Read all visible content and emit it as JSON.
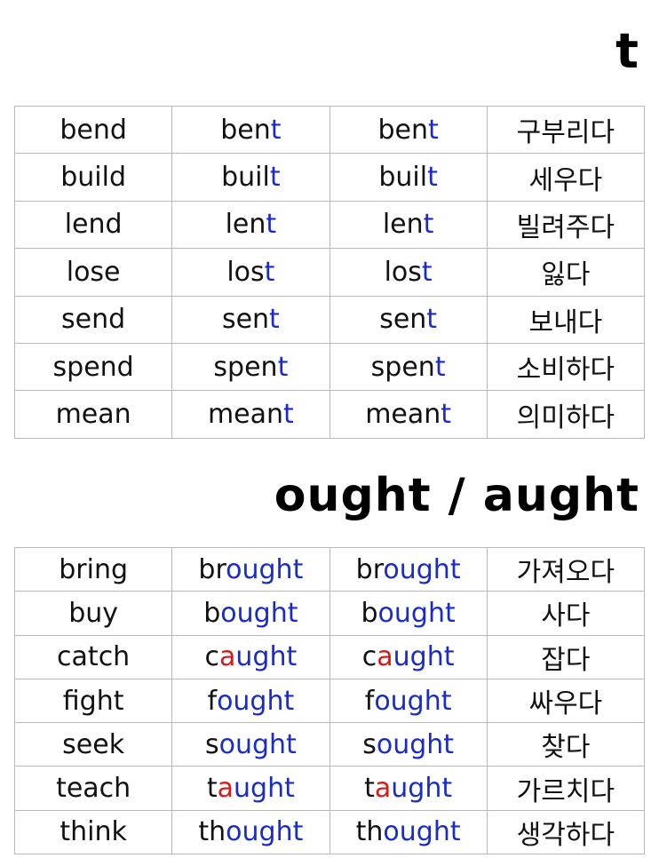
{
  "colors": {
    "changed_part": "#1a2cc7",
    "vowel_highlight": "#d61a1a",
    "text": "#111111",
    "border": "#b8b8b8"
  },
  "sections": [
    {
      "title": "t",
      "rows": [
        {
          "base": "bend",
          "past": [
            {
              "t": "ben"
            },
            {
              "t": "t",
              "c": "blue"
            }
          ],
          "pp": [
            {
              "t": "ben"
            },
            {
              "t": "t",
              "c": "blue"
            }
          ],
          "meaning": "구부리다"
        },
        {
          "base": "build",
          "past": [
            {
              "t": "buil"
            },
            {
              "t": "t",
              "c": "blue"
            }
          ],
          "pp": [
            {
              "t": "buil"
            },
            {
              "t": "t",
              "c": "blue"
            }
          ],
          "meaning": "세우다"
        },
        {
          "base": "lend",
          "past": [
            {
              "t": "len"
            },
            {
              "t": "t",
              "c": "blue"
            }
          ],
          "pp": [
            {
              "t": "len"
            },
            {
              "t": "t",
              "c": "blue"
            }
          ],
          "meaning": "빌려주다"
        },
        {
          "base": "lose",
          "past": [
            {
              "t": "los"
            },
            {
              "t": "t",
              "c": "blue"
            }
          ],
          "pp": [
            {
              "t": "los"
            },
            {
              "t": "t",
              "c": "blue"
            }
          ],
          "meaning": "잃다"
        },
        {
          "base": "send",
          "past": [
            {
              "t": "sen"
            },
            {
              "t": "t",
              "c": "blue"
            }
          ],
          "pp": [
            {
              "t": "sen"
            },
            {
              "t": "t",
              "c": "blue"
            }
          ],
          "meaning": "보내다"
        },
        {
          "base": "spend",
          "past": [
            {
              "t": "spen"
            },
            {
              "t": "t",
              "c": "blue"
            }
          ],
          "pp": [
            {
              "t": "spen"
            },
            {
              "t": "t",
              "c": "blue"
            }
          ],
          "meaning": "소비하다"
        },
        {
          "base": "mean",
          "past": [
            {
              "t": "mean"
            },
            {
              "t": "t",
              "c": "blue"
            }
          ],
          "pp": [
            {
              "t": "mean"
            },
            {
              "t": "t",
              "c": "blue"
            }
          ],
          "meaning": "의미하다"
        }
      ]
    },
    {
      "title": "ought / aught",
      "rows": [
        {
          "base": "bring",
          "past": [
            {
              "t": "br"
            },
            {
              "t": "ought",
              "c": "blue"
            }
          ],
          "pp": [
            {
              "t": "br"
            },
            {
              "t": "ought",
              "c": "blue"
            }
          ],
          "meaning": "가져오다"
        },
        {
          "base": "buy",
          "past": [
            {
              "t": "b"
            },
            {
              "t": "ought",
              "c": "blue"
            }
          ],
          "pp": [
            {
              "t": "b"
            },
            {
              "t": "ought",
              "c": "blue"
            }
          ],
          "meaning": "사다"
        },
        {
          "base": "catch",
          "past": [
            {
              "t": "c"
            },
            {
              "t": "a",
              "c": "red"
            },
            {
              "t": "ught",
              "c": "blue"
            }
          ],
          "pp": [
            {
              "t": "c"
            },
            {
              "t": "a",
              "c": "red"
            },
            {
              "t": "ught",
              "c": "blue"
            }
          ],
          "meaning": "잡다"
        },
        {
          "base": "fight",
          "past": [
            {
              "t": "f"
            },
            {
              "t": "ought",
              "c": "blue"
            }
          ],
          "pp": [
            {
              "t": "f"
            },
            {
              "t": "ought",
              "c": "blue"
            }
          ],
          "meaning": "싸우다"
        },
        {
          "base": "seek",
          "past": [
            {
              "t": "s"
            },
            {
              "t": "ought",
              "c": "blue"
            }
          ],
          "pp": [
            {
              "t": "s"
            },
            {
              "t": "ought",
              "c": "blue"
            }
          ],
          "meaning": "찾다"
        },
        {
          "base": "teach",
          "past": [
            {
              "t": "t"
            },
            {
              "t": "a",
              "c": "red"
            },
            {
              "t": "ught",
              "c": "blue"
            }
          ],
          "pp": [
            {
              "t": "t"
            },
            {
              "t": "a",
              "c": "red"
            },
            {
              "t": "ught",
              "c": "blue"
            }
          ],
          "meaning": "가르치다"
        },
        {
          "base": "think",
          "past": [
            {
              "t": "th"
            },
            {
              "t": "ought",
              "c": "blue"
            }
          ],
          "pp": [
            {
              "t": "th"
            },
            {
              "t": "ought",
              "c": "blue"
            }
          ],
          "meaning": "생각하다"
        }
      ]
    }
  ]
}
